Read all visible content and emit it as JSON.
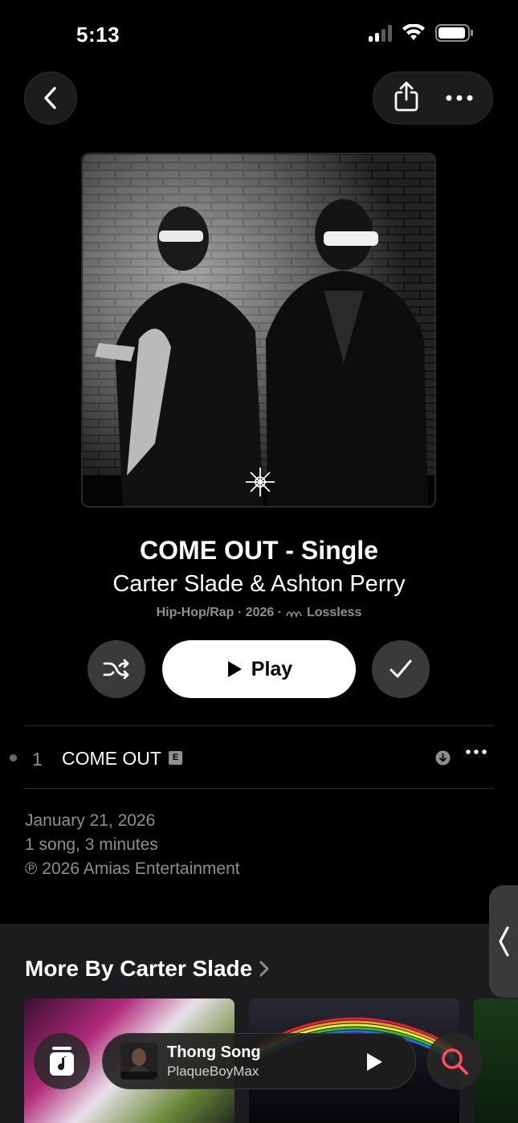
{
  "status": {
    "time": "5:13"
  },
  "album": {
    "title": "COME OUT - Single",
    "artist": "Carter Slade & Ashton Perry",
    "meta_genre_year": "Hip-Hop/Rap · 2026 · ",
    "meta_quality": "Lossless"
  },
  "actions": {
    "play_label": "Play"
  },
  "tracks": [
    {
      "number": "1",
      "title": "COME OUT",
      "explicit": "E"
    }
  ],
  "info": {
    "release_date": "January 21, 2026",
    "summary": "1 song, 3 minutes",
    "copyright": "℗ 2026 Amias Entertainment"
  },
  "more_by": {
    "title": "More By Carter Slade"
  },
  "now_playing": {
    "title": "Thong Song",
    "artist": "PlaqueBoyMax"
  },
  "icons": {
    "back": "chevron-left-icon",
    "share": "share-icon",
    "more": "ellipsis-icon",
    "shuffle": "shuffle-icon",
    "check": "checkmark-icon",
    "library": "music-note-icon",
    "search": "search-icon"
  },
  "colors": {
    "accent_search": "#ff4d5e",
    "secondary_text": "#8e8e93"
  }
}
